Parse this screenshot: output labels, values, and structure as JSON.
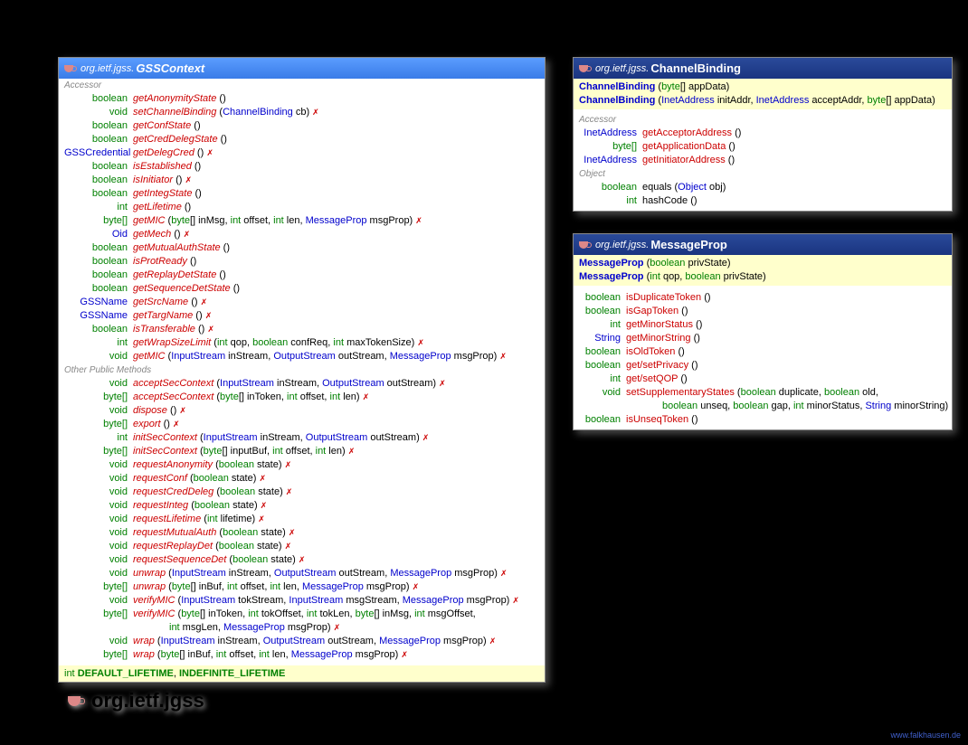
{
  "footer": "www.falkhausen.de",
  "package_label": "org.ietf.jgss",
  "gss": {
    "pkg": "org.ietf.jgss.",
    "cls": "GSSContext",
    "sec1": "Accessor",
    "rows1": [
      {
        "ret": "boolean",
        "rt": "kw",
        "m": "getAnonymityState",
        "p": " ()"
      },
      {
        "ret": "void",
        "rt": "kw",
        "m": "setChannelBinding",
        "p": " (",
        "a": [
          {
            "t": "ChannelBinding",
            "c": "typ"
          },
          {
            "t": " cb) "
          }
        ],
        "exc": 1
      },
      {
        "ret": "boolean",
        "rt": "kw",
        "m": "getConfState",
        "p": " ()"
      },
      {
        "ret": "boolean",
        "rt": "kw",
        "m": "getCredDelegState",
        "p": " ()"
      },
      {
        "ret": "GSSCredential",
        "rt": "typ",
        "m": "getDelegCred",
        "p": " () ",
        "exc": 1
      },
      {
        "ret": "boolean",
        "rt": "kw",
        "m": "isEstablished",
        "p": " ()"
      },
      {
        "ret": "boolean",
        "rt": "kw",
        "m": "isInitiator",
        "p": " () ",
        "exc": 1
      },
      {
        "ret": "boolean",
        "rt": "kw",
        "m": "getIntegState",
        "p": " ()"
      },
      {
        "ret": "int",
        "rt": "kw",
        "m": "getLifetime",
        "p": " ()"
      },
      {
        "ret": "byte[]",
        "rt": "kw",
        "m": "getMIC",
        "p": " (",
        "a": [
          {
            "t": "byte",
            "c": "kw"
          },
          {
            "t": "[] inMsg, "
          },
          {
            "t": "int",
            "c": "kw"
          },
          {
            "t": " offset, "
          },
          {
            "t": "int",
            "c": "kw"
          },
          {
            "t": " len, "
          },
          {
            "t": "MessageProp",
            "c": "typ"
          },
          {
            "t": " msgProp) "
          }
        ],
        "exc": 1
      },
      {
        "ret": "Oid",
        "rt": "typ",
        "m": "getMech",
        "p": " () ",
        "exc": 1
      },
      {
        "ret": "boolean",
        "rt": "kw",
        "m": "getMutualAuthState",
        "p": " ()"
      },
      {
        "ret": "boolean",
        "rt": "kw",
        "m": "isProtReady",
        "p": " ()"
      },
      {
        "ret": "boolean",
        "rt": "kw",
        "m": "getReplayDetState",
        "p": " ()"
      },
      {
        "ret": "boolean",
        "rt": "kw",
        "m": "getSequenceDetState",
        "p": " ()"
      },
      {
        "ret": "GSSName",
        "rt": "typ",
        "m": "getSrcName",
        "p": " () ",
        "exc": 1
      },
      {
        "ret": "GSSName",
        "rt": "typ",
        "m": "getTargName",
        "p": " () ",
        "exc": 1
      },
      {
        "ret": "boolean",
        "rt": "kw",
        "m": "isTransferable",
        "p": " () ",
        "exc": 1
      },
      {
        "ret": "int",
        "rt": "kw",
        "m": "getWrapSizeLimit",
        "p": " (",
        "a": [
          {
            "t": "int",
            "c": "kw"
          },
          {
            "t": " qop, "
          },
          {
            "t": "boolean",
            "c": "kw"
          },
          {
            "t": " confReq, "
          },
          {
            "t": "int",
            "c": "kw"
          },
          {
            "t": " maxTokenSize) "
          }
        ],
        "exc": 1
      },
      {
        "ret": "void",
        "rt": "kw",
        "m": "getMIC",
        "p": " (",
        "a": [
          {
            "t": "InputStream",
            "c": "typ"
          },
          {
            "t": " inStream, "
          },
          {
            "t": "OutputStream",
            "c": "typ"
          },
          {
            "t": " outStream, "
          },
          {
            "t": "MessageProp",
            "c": "typ"
          },
          {
            "t": " msgProp) "
          }
        ],
        "exc": 1
      }
    ],
    "sec2": "Other Public Methods",
    "rows2": [
      {
        "ret": "void",
        "rt": "kw",
        "m": "acceptSecContext",
        "p": " (",
        "a": [
          {
            "t": "InputStream",
            "c": "typ"
          },
          {
            "t": " inStream, "
          },
          {
            "t": "OutputStream",
            "c": "typ"
          },
          {
            "t": " outStream) "
          }
        ],
        "exc": 1
      },
      {
        "ret": "byte[]",
        "rt": "kw",
        "m": "acceptSecContext",
        "p": " (",
        "a": [
          {
            "t": "byte",
            "c": "kw"
          },
          {
            "t": "[] inToken, "
          },
          {
            "t": "int",
            "c": "kw"
          },
          {
            "t": " offset, "
          },
          {
            "t": "int",
            "c": "kw"
          },
          {
            "t": " len) "
          }
        ],
        "exc": 1
      },
      {
        "ret": "void",
        "rt": "kw",
        "m": "dispose",
        "p": " () ",
        "exc": 1
      },
      {
        "ret": "byte[]",
        "rt": "kw",
        "m": "export",
        "p": " () ",
        "exc": 1
      },
      {
        "ret": "int",
        "rt": "kw",
        "m": "initSecContext",
        "p": " (",
        "a": [
          {
            "t": "InputStream",
            "c": "typ"
          },
          {
            "t": " inStream, "
          },
          {
            "t": "OutputStream",
            "c": "typ"
          },
          {
            "t": " outStream) "
          }
        ],
        "exc": 1
      },
      {
        "ret": "byte[]",
        "rt": "kw",
        "m": "initSecContext",
        "p": " (",
        "a": [
          {
            "t": "byte",
            "c": "kw"
          },
          {
            "t": "[] inputBuf, "
          },
          {
            "t": "int",
            "c": "kw"
          },
          {
            "t": " offset, "
          },
          {
            "t": "int",
            "c": "kw"
          },
          {
            "t": " len) "
          }
        ],
        "exc": 1
      },
      {
        "ret": "void",
        "rt": "kw",
        "m": "requestAnonymity",
        "p": " (",
        "a": [
          {
            "t": "boolean",
            "c": "kw"
          },
          {
            "t": " state) "
          }
        ],
        "exc": 1
      },
      {
        "ret": "void",
        "rt": "kw",
        "m": "requestConf",
        "p": " (",
        "a": [
          {
            "t": "boolean",
            "c": "kw"
          },
          {
            "t": " state) "
          }
        ],
        "exc": 1
      },
      {
        "ret": "void",
        "rt": "kw",
        "m": "requestCredDeleg",
        "p": " (",
        "a": [
          {
            "t": "boolean",
            "c": "kw"
          },
          {
            "t": " state) "
          }
        ],
        "exc": 1
      },
      {
        "ret": "void",
        "rt": "kw",
        "m": "requestInteg",
        "p": " (",
        "a": [
          {
            "t": "boolean",
            "c": "kw"
          },
          {
            "t": " state) "
          }
        ],
        "exc": 1
      },
      {
        "ret": "void",
        "rt": "kw",
        "m": "requestLifetime",
        "p": " (",
        "a": [
          {
            "t": "int",
            "c": "kw"
          },
          {
            "t": " lifetime) "
          }
        ],
        "exc": 1
      },
      {
        "ret": "void",
        "rt": "kw",
        "m": "requestMutualAuth",
        "p": " (",
        "a": [
          {
            "t": "boolean",
            "c": "kw"
          },
          {
            "t": " state) "
          }
        ],
        "exc": 1
      },
      {
        "ret": "void",
        "rt": "kw",
        "m": "requestReplayDet",
        "p": " (",
        "a": [
          {
            "t": "boolean",
            "c": "kw"
          },
          {
            "t": " state) "
          }
        ],
        "exc": 1
      },
      {
        "ret": "void",
        "rt": "kw",
        "m": "requestSequenceDet",
        "p": " (",
        "a": [
          {
            "t": "boolean",
            "c": "kw"
          },
          {
            "t": " state) "
          }
        ],
        "exc": 1
      },
      {
        "ret": "void",
        "rt": "kw",
        "m": "unwrap",
        "p": " (",
        "a": [
          {
            "t": "InputStream",
            "c": "typ"
          },
          {
            "t": " inStream, "
          },
          {
            "t": "OutputStream",
            "c": "typ"
          },
          {
            "t": " outStream, "
          },
          {
            "t": "MessageProp",
            "c": "typ"
          },
          {
            "t": " msgProp) "
          }
        ],
        "exc": 1
      },
      {
        "ret": "byte[]",
        "rt": "kw",
        "m": "unwrap",
        "p": " (",
        "a": [
          {
            "t": "byte",
            "c": "kw"
          },
          {
            "t": "[] inBuf, "
          },
          {
            "t": "int",
            "c": "kw"
          },
          {
            "t": " offset, "
          },
          {
            "t": "int",
            "c": "kw"
          },
          {
            "t": " len, "
          },
          {
            "t": "MessageProp",
            "c": "typ"
          },
          {
            "t": " msgProp) "
          }
        ],
        "exc": 1
      },
      {
        "ret": "void",
        "rt": "kw",
        "m": "verifyMIC",
        "p": " (",
        "a": [
          {
            "t": "InputStream",
            "c": "typ"
          },
          {
            "t": " tokStream, "
          },
          {
            "t": "InputStream",
            "c": "typ"
          },
          {
            "t": " msgStream, "
          },
          {
            "t": "MessageProp",
            "c": "typ"
          },
          {
            "t": " msgProp) "
          }
        ],
        "exc": 1
      },
      {
        "ret": "byte[]",
        "rt": "kw",
        "m": "verifyMIC",
        "p": " (",
        "a": [
          {
            "t": "byte",
            "c": "kw"
          },
          {
            "t": "[] inToken, "
          },
          {
            "t": "int",
            "c": "kw"
          },
          {
            "t": " tokOffset, "
          },
          {
            "t": "int",
            "c": "kw"
          },
          {
            "t": " tokLen, "
          },
          {
            "t": "byte",
            "c": "kw"
          },
          {
            "t": "[] inMsg, "
          },
          {
            "t": "int",
            "c": "kw"
          },
          {
            "t": " msgOffset,"
          }
        ],
        "cont": [
          {
            "t": "int",
            "c": "kw"
          },
          {
            "t": " msgLen, "
          },
          {
            "t": "MessageProp",
            "c": "typ"
          },
          {
            "t": " msgProp) "
          }
        ],
        "exc": 1,
        "excOnCont": 1
      },
      {
        "ret": "void",
        "rt": "kw",
        "m": "wrap",
        "p": " (",
        "a": [
          {
            "t": "InputStream",
            "c": "typ"
          },
          {
            "t": " inStream, "
          },
          {
            "t": "OutputStream",
            "c": "typ"
          },
          {
            "t": " outStream, "
          },
          {
            "t": "MessageProp",
            "c": "typ"
          },
          {
            "t": " msgProp) "
          }
        ],
        "exc": 1
      },
      {
        "ret": "byte[]",
        "rt": "kw",
        "m": "wrap",
        "p": " (",
        "a": [
          {
            "t": "byte",
            "c": "kw"
          },
          {
            "t": "[] inBuf, "
          },
          {
            "t": "int",
            "c": "kw"
          },
          {
            "t": " offset, "
          },
          {
            "t": "int",
            "c": "kw"
          },
          {
            "t": " len, "
          },
          {
            "t": "MessageProp",
            "c": "typ"
          },
          {
            "t": " msgProp) "
          }
        ],
        "exc": 1
      }
    ],
    "const_kw": "int",
    "const1": "DEFAULT_LIFETIME",
    "const2": "INDEFINITE_LIFETIME"
  },
  "cb": {
    "pkg": "org.ietf.jgss.",
    "cls": "ChannelBinding",
    "ctors": [
      {
        "n": "ChannelBinding",
        "a": [
          {
            "t": " ("
          },
          {
            "t": "byte",
            "c": "kw"
          },
          {
            "t": "[] appData)"
          }
        ]
      },
      {
        "n": "ChannelBinding",
        "a": [
          {
            "t": " ("
          },
          {
            "t": "InetAddress",
            "c": "typ"
          },
          {
            "t": " initAddr, "
          },
          {
            "t": "InetAddress",
            "c": "typ"
          },
          {
            "t": " acceptAddr, "
          },
          {
            "t": "byte",
            "c": "kw"
          },
          {
            "t": "[] appData)"
          }
        ]
      }
    ],
    "sec1": "Accessor",
    "rows1": [
      {
        "ret": "InetAddress",
        "rt": "typ",
        "m": "getAcceptorAddress",
        "p": " ()",
        "plain": 1
      },
      {
        "ret": "byte[]",
        "rt": "kw",
        "m": "getApplicationData",
        "p": " ()",
        "plain": 1
      },
      {
        "ret": "InetAddress",
        "rt": "typ",
        "m": "getInitiatorAddress",
        "p": " ()",
        "plain": 1
      }
    ],
    "sec2": "Object",
    "rows2": [
      {
        "ret": "boolean",
        "rt": "kw",
        "m": "equals",
        "p": " (",
        "a": [
          {
            "t": "Object",
            "c": "typ"
          },
          {
            "t": " obj)"
          }
        ],
        "black": 1
      },
      {
        "ret": "int",
        "rt": "kw",
        "m": "hashCode",
        "p": " ()",
        "black": 1
      }
    ]
  },
  "mp": {
    "pkg": "org.ietf.jgss.",
    "cls": "MessageProp",
    "ctors": [
      {
        "n": "MessageProp",
        "a": [
          {
            "t": " ("
          },
          {
            "t": "boolean",
            "c": "kw"
          },
          {
            "t": " privState)"
          }
        ]
      },
      {
        "n": "MessageProp",
        "a": [
          {
            "t": " ("
          },
          {
            "t": "int",
            "c": "kw"
          },
          {
            "t": " qop, "
          },
          {
            "t": "boolean",
            "c": "kw"
          },
          {
            "t": " privState)"
          }
        ]
      }
    ],
    "rows": [
      {
        "ret": "boolean",
        "rt": "kw",
        "m": "isDuplicateToken",
        "p": " ()",
        "plain": 1
      },
      {
        "ret": "boolean",
        "rt": "kw",
        "m": "isGapToken",
        "p": " ()",
        "plain": 1
      },
      {
        "ret": "int",
        "rt": "kw",
        "m": "getMinorStatus",
        "p": " ()",
        "plain": 1
      },
      {
        "ret": "String",
        "rt": "typ",
        "m": "getMinorString",
        "p": " ()",
        "plain": 1
      },
      {
        "ret": "boolean",
        "rt": "kw",
        "m": "isOldToken",
        "p": " ()",
        "plain": 1
      },
      {
        "ret": "boolean",
        "rt": "kw",
        "m": "get/setPrivacy",
        "p": " ()",
        "plain": 1
      },
      {
        "ret": "int",
        "rt": "kw",
        "m": "get/setQOP",
        "p": " ()",
        "plain": 1
      },
      {
        "ret": "void",
        "rt": "kw",
        "m": "setSupplementaryStates",
        "p": " (",
        "a": [
          {
            "t": "boolean",
            "c": "kw"
          },
          {
            "t": " duplicate, "
          },
          {
            "t": "boolean",
            "c": "kw"
          },
          {
            "t": " old,"
          }
        ],
        "cont": [
          {
            "t": "boolean",
            "c": "kw"
          },
          {
            "t": " unseq, "
          },
          {
            "t": "boolean",
            "c": "kw"
          },
          {
            "t": " gap, "
          },
          {
            "t": "int",
            "c": "kw"
          },
          {
            "t": " minorStatus, "
          },
          {
            "t": "String",
            "c": "typ"
          },
          {
            "t": " minorString)"
          }
        ],
        "plain": 1
      },
      {
        "ret": "boolean",
        "rt": "kw",
        "m": "isUnseqToken",
        "p": " ()",
        "plain": 1
      }
    ]
  }
}
